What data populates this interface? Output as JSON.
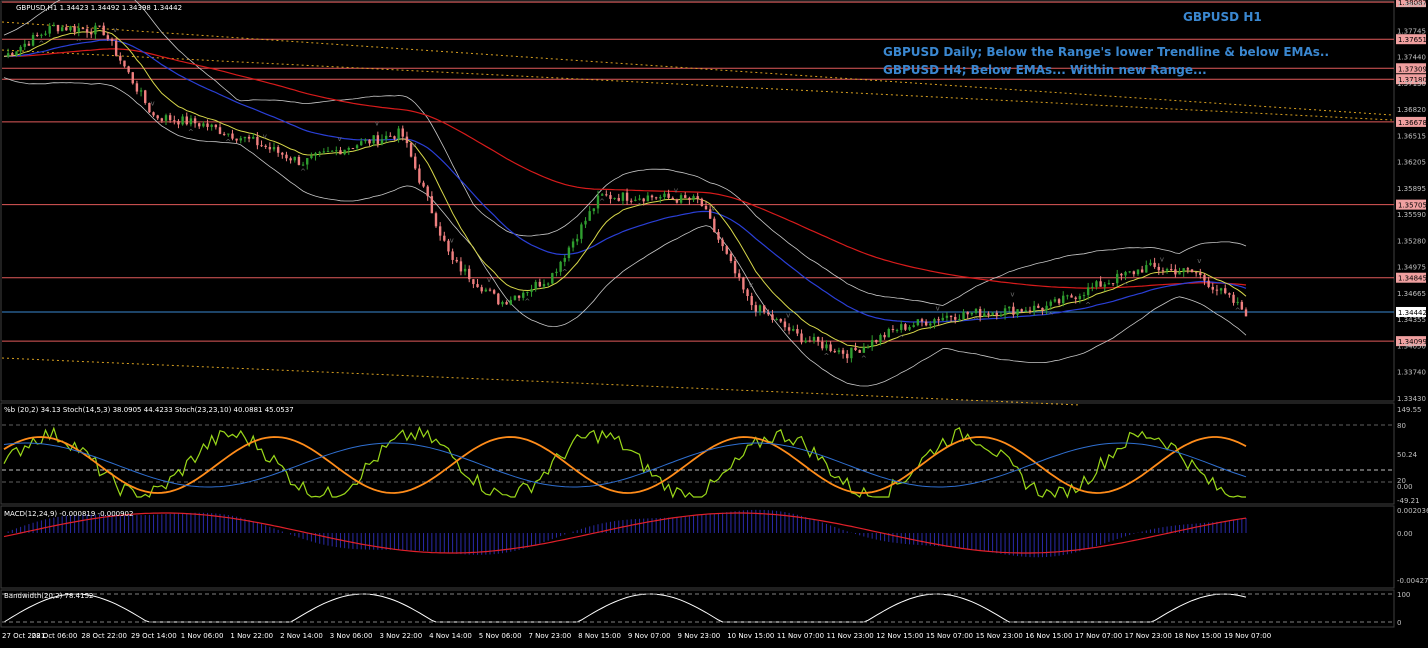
{
  "window": {
    "symbol_header": "GBPUSD,H1  1.34423 1.34492 1.34398 1.34442",
    "title": "GBPUSD H1",
    "annotations": [
      "GBPUSD Daily; Below the Range's lower Trendline & below EMAs..",
      "GBPUSD H4; Below EMAs... Within new Range..."
    ]
  },
  "colors": {
    "background": "#000000",
    "bull_candle": "#2f9e2f",
    "bear_candle": "#f08080",
    "ema_red": "#d81b1b",
    "ema_blue": "#2a3fd6",
    "ema_yellow": "#d8d84a",
    "bollinger": "#c8c8c8",
    "horizontal_lines": "#e05a5a",
    "trendline": "#d8a020",
    "stoch_fast": "#9ad81a",
    "stoch_slow": "#ff8c1a",
    "percent_b": "#2f6fd0",
    "macd_hist": "#2a2aa8",
    "macd_signal": "#e0202a",
    "bandwidth": "#ffffff",
    "annotation_text": "#3a87d0"
  },
  "price_axis": {
    "ticks": [
      "1.38065",
      "1.37745",
      "1.37440",
      "1.37130",
      "1.36820",
      "1.36515",
      "1.36205",
      "1.35895",
      "1.35590",
      "1.35280",
      "1.34975",
      "1.34665",
      "1.34355",
      "1.34050",
      "1.33740",
      "1.33430"
    ],
    "level_labels": [
      {
        "label": "1.38087",
        "value": 1.38087
      },
      {
        "label": "1.37651",
        "value": 1.37651
      },
      {
        "label": "1.37309",
        "value": 1.37309
      },
      {
        "label": "1.37180",
        "value": 1.3718
      },
      {
        "label": "1.36678",
        "value": 1.36678
      },
      {
        "label": "1.35705",
        "value": 1.35705
      },
      {
        "label": "1.34845",
        "value": 1.34845
      },
      {
        "label": "1.34099",
        "value": 1.34099
      }
    ],
    "current_price": "1.34442"
  },
  "time_axis": {
    "labels": [
      "27 Oct 2021",
      "28 Oct 06:00",
      "28 Oct 22:00",
      "29 Oct 14:00",
      "1 Nov 06:00",
      "1 Nov 22:00",
      "2 Nov 14:00",
      "3 Nov 06:00",
      "3 Nov 22:00",
      "4 Nov 14:00",
      "5 Nov 06:00",
      "7 Nov 23:00",
      "8 Nov 15:00",
      "9 Nov 07:00",
      "9 Nov 23:00",
      "10 Nov 15:00",
      "11 Nov 07:00",
      "11 Nov 23:00",
      "12 Nov 15:00",
      "15 Nov 07:00",
      "15 Nov 23:00",
      "16 Nov 15:00",
      "17 Nov 07:00",
      "17 Nov 23:00",
      "18 Nov 15:00",
      "19 Nov 07:00"
    ]
  },
  "indicators": {
    "stoch": {
      "label": "%b (20,2) 34.13  Stoch(14,5,3) 38.0905 44.4233  Stoch(23,23,10) 40.0881 45.0537",
      "ticks": [
        "149.55",
        "80",
        "50.24",
        "20",
        "0.00",
        "-49.21"
      ]
    },
    "macd": {
      "label": "MACD(12,24,9) -0.000819 -0.000902",
      "ticks": [
        "0.002036",
        "0.00",
        "-0.004274"
      ]
    },
    "bandwidth": {
      "label": "Bandwidth(20,2) 78.4152",
      "ticks": [
        "100",
        "0"
      ]
    }
  },
  "chart_data": {
    "type": "line",
    "title": "GBPUSD H1",
    "series": [
      {
        "name": "GBPUSD",
        "x": [
          "27 Oct 2021",
          "28 Oct 06:00",
          "28 Oct 22:00",
          "29 Oct 14:00",
          "1 Nov 06:00",
          "1 Nov 22:00",
          "2 Nov 14:00",
          "3 Nov 06:00",
          "3 Nov 22:00",
          "4 Nov 14:00",
          "5 Nov 06:00",
          "7 Nov 23:00",
          "8 Nov 15:00",
          "9 Nov 07:00",
          "9 Nov 23:00",
          "10 Nov 15:00",
          "11 Nov 07:00",
          "11 Nov 23:00",
          "12 Nov 15:00",
          "15 Nov 07:00",
          "15 Nov 23:00",
          "16 Nov 15:00",
          "17 Nov 07:00",
          "17 Nov 23:00",
          "18 Nov 15:00",
          "19 Nov 07:00"
        ],
        "values": [
          1.3745,
          1.378,
          1.3775,
          1.3675,
          1.3665,
          1.3645,
          1.362,
          1.364,
          1.3655,
          1.3505,
          1.3455,
          1.3485,
          1.358,
          1.358,
          1.3575,
          1.3455,
          1.3415,
          1.3395,
          1.3425,
          1.344,
          1.3445,
          1.345,
          1.3475,
          1.3497,
          1.349,
          1.3444
        ]
      }
    ],
    "ylim": [
      1.3343,
      1.38065
    ],
    "grid": false
  }
}
